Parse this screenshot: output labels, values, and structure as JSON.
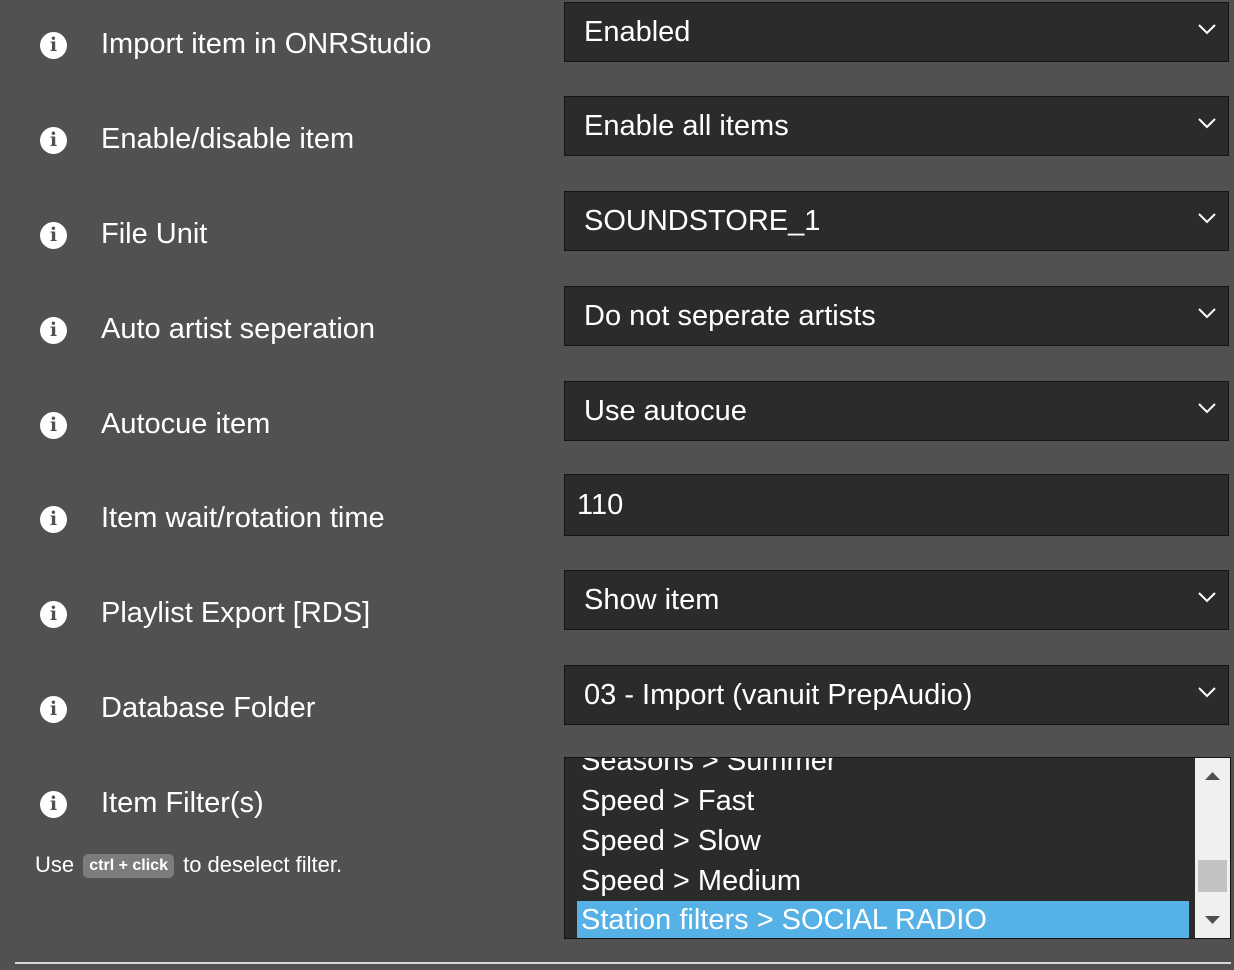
{
  "settings": [
    {
      "label": "Import item in ONRStudio",
      "control": "select",
      "value": "Enabled"
    },
    {
      "label": "Enable/disable item",
      "control": "select",
      "value": "Enable all items"
    },
    {
      "label": "File Unit",
      "control": "select",
      "value": "SOUNDSTORE_1"
    },
    {
      "label": "Auto artist seperation",
      "control": "select",
      "value": "Do not seperate artists"
    },
    {
      "label": "Autocue item",
      "control": "select",
      "value": "Use autocue"
    },
    {
      "label": "Item wait/rotation time",
      "control": "text",
      "value": "110"
    },
    {
      "label": "Playlist Export [RDS]",
      "control": "select",
      "value": "Show item"
    },
    {
      "label": "Database Folder",
      "control": "select",
      "value": "03 - Import (vanuit PrepAudio)"
    }
  ],
  "item_filters": {
    "label": "Item Filter(s)",
    "hint_prefix": "Use",
    "hint_key": "ctrl + click",
    "hint_suffix": "to deselect filter.",
    "options": [
      "Seasons > Summer",
      "Speed > Fast",
      "Speed > Slow",
      "Speed > Medium",
      "Station filters > SOCIAL RADIO"
    ],
    "selected": "Station filters > SOCIAL RADIO"
  },
  "icons": {
    "info": "info-icon",
    "dropdown": "chevron-down-icon",
    "scroll_up": "arrow-up-icon",
    "scroll_down": "arrow-down-icon"
  },
  "colors": {
    "background": "#515150",
    "field": "#2b2b2a",
    "selected": "#56b1e6"
  }
}
